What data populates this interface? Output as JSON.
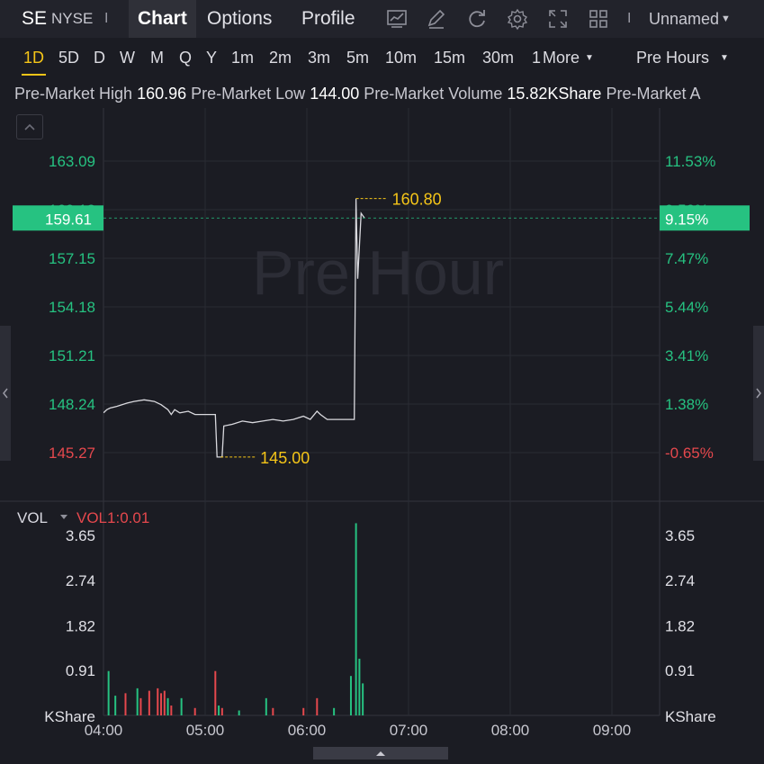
{
  "header": {
    "symbol": "SE",
    "exchange": "NYSE",
    "separator": "I",
    "tabs": [
      "Chart",
      "Options",
      "Profile"
    ],
    "layout_name": "Unnamed",
    "icons": [
      "indicator-icon",
      "draw-icon",
      "refresh-icon",
      "settings-icon",
      "fullscreen-icon",
      "layout-grid-icon"
    ]
  },
  "intervals": {
    "items": [
      "1D",
      "5D",
      "D",
      "W",
      "M",
      "Q",
      "Y",
      "1m",
      "2m",
      "3m",
      "5m",
      "10m",
      "15m",
      "30m",
      "1"
    ],
    "active": "1D",
    "more_label": "More",
    "session_label": "Pre Hours"
  },
  "info": {
    "high_label": "Pre-Market High",
    "high_value": "160.96",
    "low_label": "Pre-Market Low",
    "low_value": "144.00",
    "volume_label": "Pre-Market Volume",
    "volume_value": "15.82KShare",
    "avg_label_partial": "Pre-Market A"
  },
  "colors": {
    "background": "#1b1c23",
    "up": "#26c281",
    "down": "#e5484d",
    "accent": "#f5c518",
    "price_line": "#d9d9de"
  },
  "chart_data": {
    "type": "line",
    "watermark": "Pre Hour",
    "price_axis_left": [
      "163.09",
      "160.12",
      "157.15",
      "154.18",
      "151.21",
      "148.24",
      "145.27"
    ],
    "price_axis_right": [
      "11.53%",
      "9.50%",
      "7.47%",
      "5.44%",
      "3.41%",
      "1.38%",
      "-0.65%"
    ],
    "current_price": "159.61",
    "current_pct": "9.15%",
    "high_marker": "160.80",
    "low_marker": "145.00",
    "ylim": [
      144.0,
      164.5
    ],
    "xlim": [
      0,
      360
    ],
    "x_ticks": [
      "04:00",
      "05:00",
      "06:00",
      "07:00",
      "08:00",
      "09:00"
    ],
    "series": [
      {
        "points": [
          [
            0,
            147.7
          ],
          [
            2,
            147.9
          ],
          [
            4,
            148.0
          ],
          [
            8,
            148.1
          ],
          [
            14,
            148.3
          ],
          [
            18,
            148.4
          ],
          [
            24,
            148.5
          ],
          [
            30,
            148.4
          ],
          [
            34,
            148.2
          ],
          [
            38,
            147.9
          ],
          [
            40,
            147.6
          ],
          [
            42,
            147.9
          ],
          [
            45,
            147.7
          ],
          [
            50,
            147.8
          ],
          [
            54,
            147.6
          ],
          [
            60,
            147.6
          ],
          [
            66,
            147.6
          ],
          [
            67,
            145.0
          ],
          [
            70,
            145.0
          ],
          [
            71,
            146.9
          ],
          [
            76,
            147.0
          ],
          [
            82,
            147.2
          ],
          [
            88,
            147.1
          ],
          [
            94,
            147.2
          ],
          [
            100,
            147.3
          ],
          [
            106,
            147.2
          ],
          [
            112,
            147.3
          ],
          [
            118,
            147.5
          ],
          [
            122,
            147.3
          ],
          [
            126,
            147.8
          ],
          [
            128,
            147.6
          ],
          [
            132,
            147.3
          ],
          [
            148,
            147.3
          ],
          [
            149,
            160.8
          ],
          [
            150,
            155.9
          ],
          [
            152,
            159.9
          ],
          [
            154,
            159.61
          ]
        ]
      }
    ],
    "volume": {
      "title": "VOL",
      "indicator": "VOL1:0.01",
      "axis": [
        "3.65",
        "2.74",
        "1.82",
        "0.91"
      ],
      "unit": "KShare",
      "ylim": [
        0,
        4.2
      ],
      "bars": [
        [
          3,
          0.9,
          "up"
        ],
        [
          7,
          0.4,
          "up"
        ],
        [
          13,
          0.45,
          "down"
        ],
        [
          20,
          0.55,
          "up"
        ],
        [
          22,
          0.35,
          "down"
        ],
        [
          27,
          0.5,
          "down"
        ],
        [
          32,
          0.55,
          "down"
        ],
        [
          34,
          0.45,
          "down"
        ],
        [
          36,
          0.5,
          "down"
        ],
        [
          38,
          0.35,
          "up"
        ],
        [
          40,
          0.2,
          "down"
        ],
        [
          46,
          0.35,
          "up"
        ],
        [
          54,
          0.15,
          "down"
        ],
        [
          66,
          0.9,
          "down"
        ],
        [
          68,
          0.2,
          "up"
        ],
        [
          70,
          0.15,
          "down"
        ],
        [
          80,
          0.1,
          "up"
        ],
        [
          96,
          0.35,
          "up"
        ],
        [
          100,
          0.15,
          "down"
        ],
        [
          118,
          0.15,
          "down"
        ],
        [
          126,
          0.35,
          "down"
        ],
        [
          136,
          0.15,
          "up"
        ],
        [
          146,
          0.8,
          "up"
        ],
        [
          149,
          3.9,
          "up"
        ],
        [
          151,
          1.15,
          "up"
        ],
        [
          153,
          0.65,
          "up"
        ]
      ]
    }
  }
}
